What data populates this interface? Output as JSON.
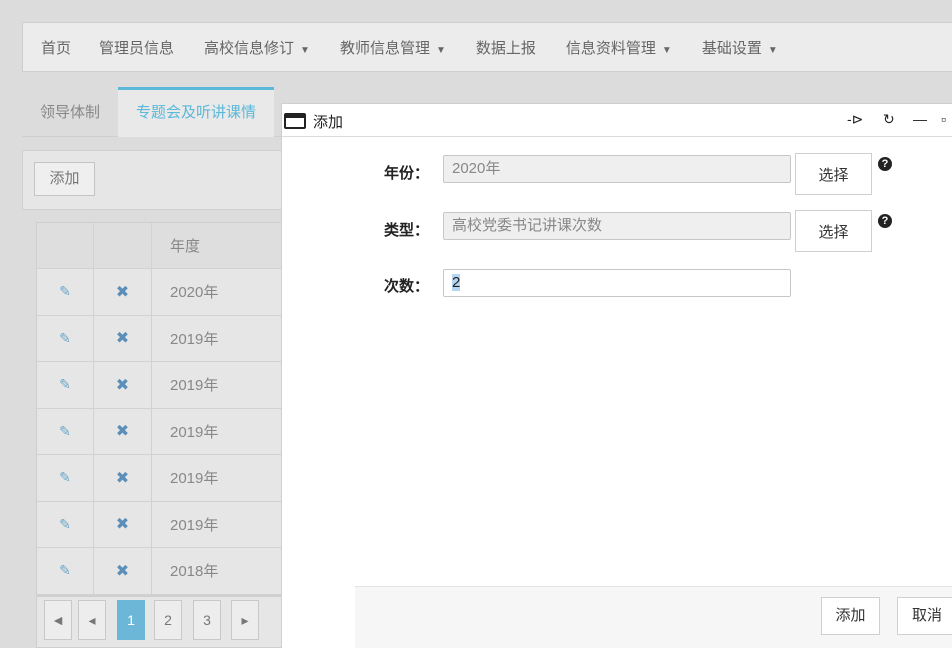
{
  "nav": {
    "items": [
      {
        "label": "首页",
        "dropdown": false
      },
      {
        "label": "管理员信息",
        "dropdown": false
      },
      {
        "label": "高校信息修订",
        "dropdown": true
      },
      {
        "label": "教师信息管理",
        "dropdown": true
      },
      {
        "label": "数据上报",
        "dropdown": false
      },
      {
        "label": "信息资料管理",
        "dropdown": true
      },
      {
        "label": "基础设置",
        "dropdown": true
      }
    ],
    "caret": "▼"
  },
  "tabs": [
    {
      "label": "领导体制",
      "active": false
    },
    {
      "label": "专题会及听讲课情",
      "active": true
    }
  ],
  "toolbar": {
    "add_label": "添加"
  },
  "table": {
    "header": "年度",
    "rows": [
      "2020年",
      "2019年",
      "2019年",
      "2019年",
      "2019年",
      "2019年",
      "2018年"
    ]
  },
  "pager": {
    "first": "⏮",
    "prev": "◂",
    "pages": [
      "1",
      "2",
      "3"
    ],
    "next": "▸",
    "current": "1"
  },
  "dialog": {
    "title": "添加",
    "controls": {
      "pin": "-⊳",
      "refresh": "↻",
      "minimize": "—"
    },
    "fields": [
      {
        "label": "年份：",
        "value": "2020年",
        "readonly": true,
        "button": "选择",
        "help": "?"
      },
      {
        "label": "类型：",
        "value": "高校党委书记讲课次数",
        "readonly": true,
        "button": "选择",
        "help": "?"
      },
      {
        "label": "次数：",
        "value": "2",
        "readonly": false
      }
    ],
    "footer": {
      "add_label": "添加",
      "cancel_label": "取消"
    }
  },
  "colors": {
    "accent": "#5bb8d8",
    "active_page": "#6cb6d8",
    "selection": "#b5d5f3"
  }
}
